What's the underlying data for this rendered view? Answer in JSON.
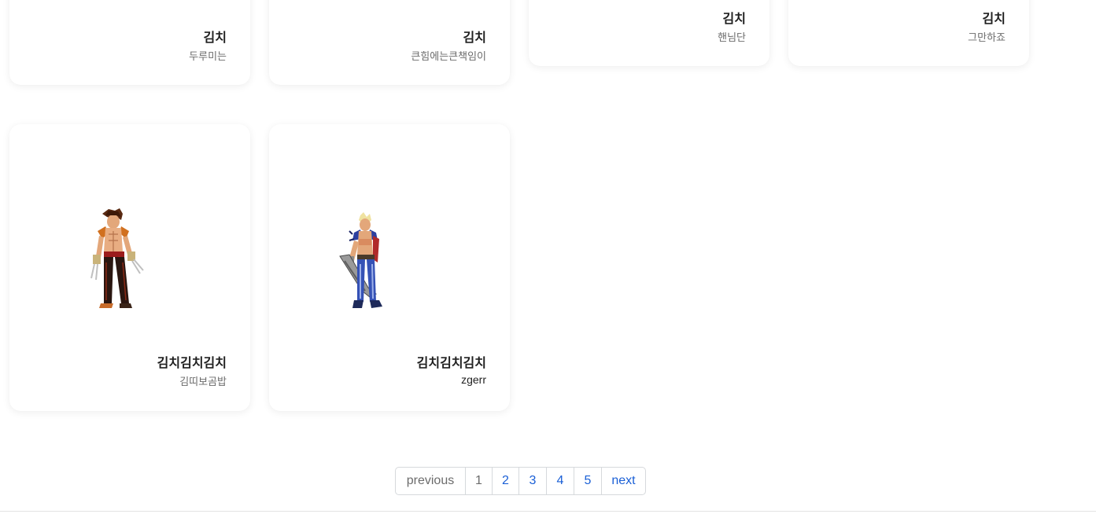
{
  "cards_top": [
    {
      "title": "김치",
      "subtitle": "두루미는"
    },
    {
      "title": "김치",
      "subtitle": "큰힘에는큰책임이"
    },
    {
      "title": "김치",
      "subtitle": "핸님단"
    },
    {
      "title": "김치",
      "subtitle": "그만하죠"
    }
  ],
  "cards_bottom": [
    {
      "title": "김치김치김치",
      "subtitle": "김띠보곰밥",
      "image": "fighter-character-sprite"
    },
    {
      "title": "김치김치김치",
      "subtitle": "zgerr",
      "image": "swordsman-character-sprite"
    }
  ],
  "pagination": {
    "previous": "previous",
    "pages": [
      "1",
      "2",
      "3",
      "4",
      "5"
    ],
    "current": "1",
    "next": "next"
  },
  "colors": {
    "link": "#1a5fd6",
    "muted": "#6c6c6c",
    "card_bg": "#ffffff"
  }
}
